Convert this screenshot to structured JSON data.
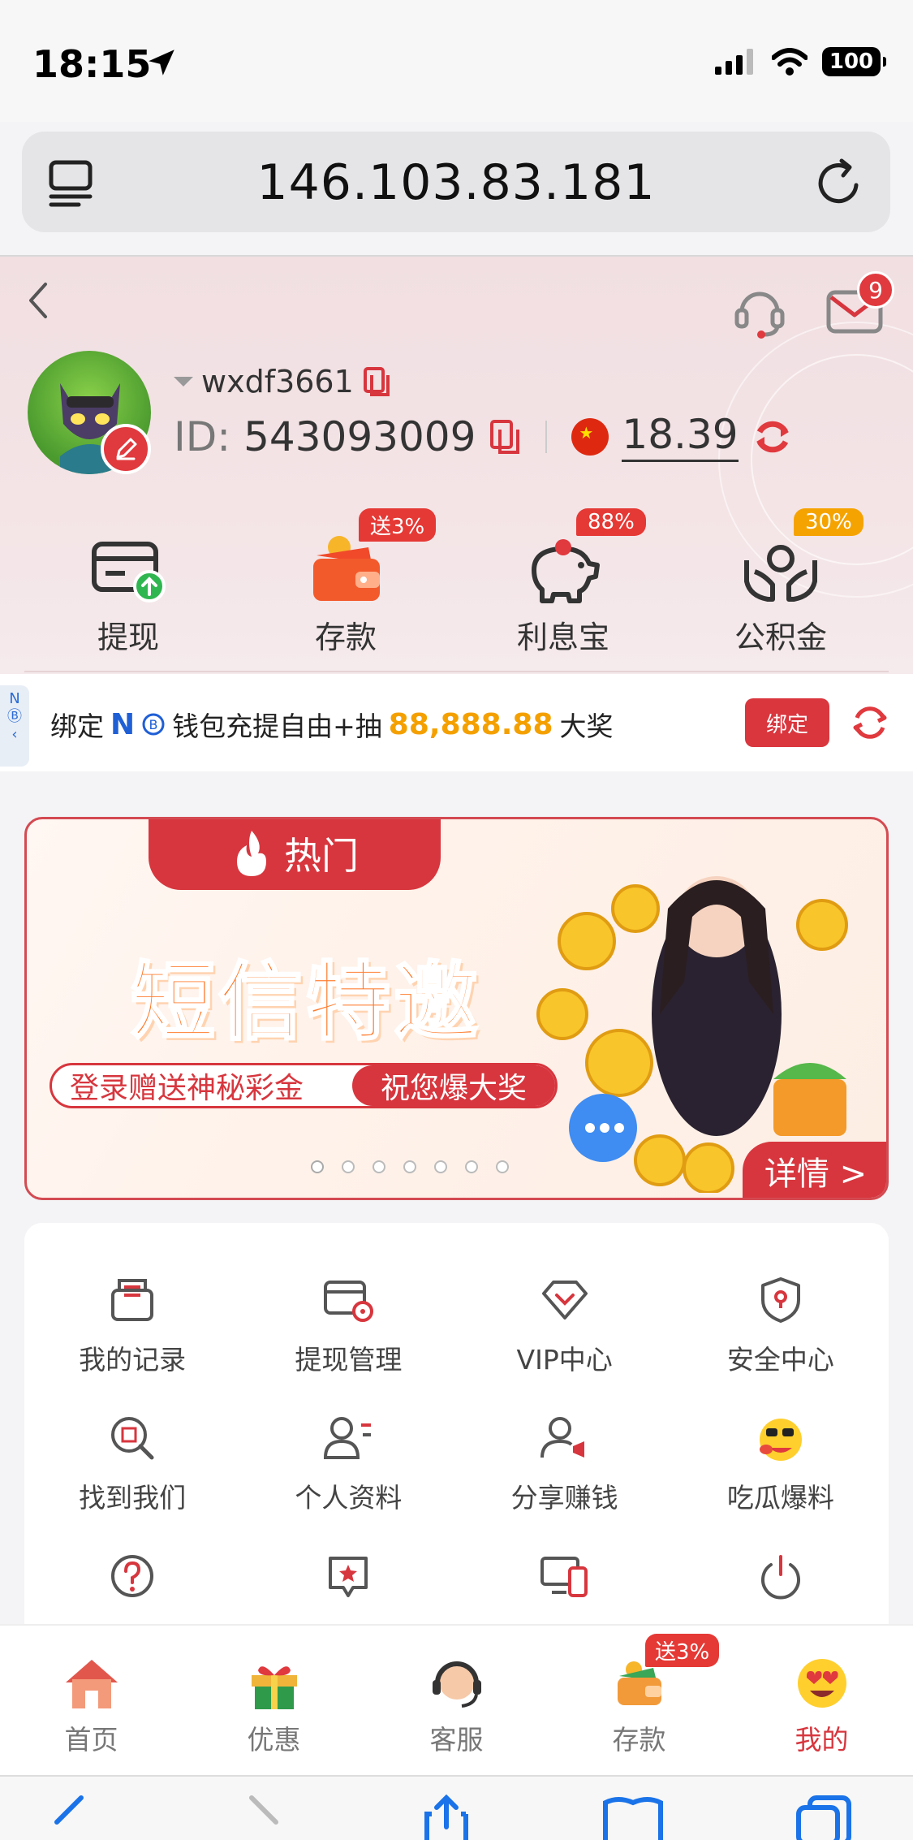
{
  "status_bar": {
    "time": "18:15",
    "battery": "100"
  },
  "browser": {
    "url": "146.103.83.181"
  },
  "header": {
    "mail_badge": "9",
    "username": "wxdf3661",
    "id_label": "ID:",
    "id_value": "543093009",
    "balance": "18.39"
  },
  "quick_actions": [
    {
      "label": "提现",
      "icon": "withdraw-icon"
    },
    {
      "label": "存款",
      "icon": "wallet-icon",
      "badge": "送3%"
    },
    {
      "label": "利息宝",
      "icon": "piggy-bank-icon",
      "badge": "88%"
    },
    {
      "label": "公积金",
      "icon": "fund-hands-icon",
      "badge": "30%"
    }
  ],
  "bind_bar": {
    "side_text": "N",
    "prefix": "绑定",
    "brand": "N",
    "text": "钱包充提自由+抽",
    "amount": "88,888.88",
    "suffix": "大奖",
    "button": "绑定"
  },
  "banner": {
    "tab": "热门",
    "title": "短信特邀",
    "pill_left": "登录赠送神秘彩金",
    "pill_right": "祝您爆大奖",
    "detail": "详情 >",
    "dots": 7,
    "active_dot": 0
  },
  "menu": [
    {
      "label": "我的记录",
      "icon": "record-icon"
    },
    {
      "label": "提现管理",
      "icon": "withdraw-manage-icon"
    },
    {
      "label": "VIP中心",
      "icon": "vip-icon"
    },
    {
      "label": "安全中心",
      "icon": "shield-icon"
    },
    {
      "label": "找到我们",
      "icon": "search-doc-icon"
    },
    {
      "label": "个人资料",
      "icon": "profile-icon"
    },
    {
      "label": "分享赚钱",
      "icon": "share-icon"
    },
    {
      "label": "吃瓜爆料",
      "icon": "emoji-icon"
    },
    {
      "label": "",
      "icon": "help-icon"
    },
    {
      "label": "",
      "icon": "star-chat-icon"
    },
    {
      "label": "",
      "icon": "devices-icon"
    },
    {
      "label": "",
      "icon": "power-icon"
    }
  ],
  "tabbar": [
    {
      "label": "首页",
      "icon": "home-icon"
    },
    {
      "label": "优惠",
      "icon": "gift-icon"
    },
    {
      "label": "客服",
      "icon": "support-icon"
    },
    {
      "label": "存款",
      "icon": "wallet-icon",
      "badge": "送3%"
    },
    {
      "label": "我的",
      "icon": "heart-eyes-icon",
      "active": true
    }
  ],
  "colors": {
    "accent": "#d7363e",
    "gold": "#f4a000",
    "brand_blue": "#1f5fd6"
  }
}
